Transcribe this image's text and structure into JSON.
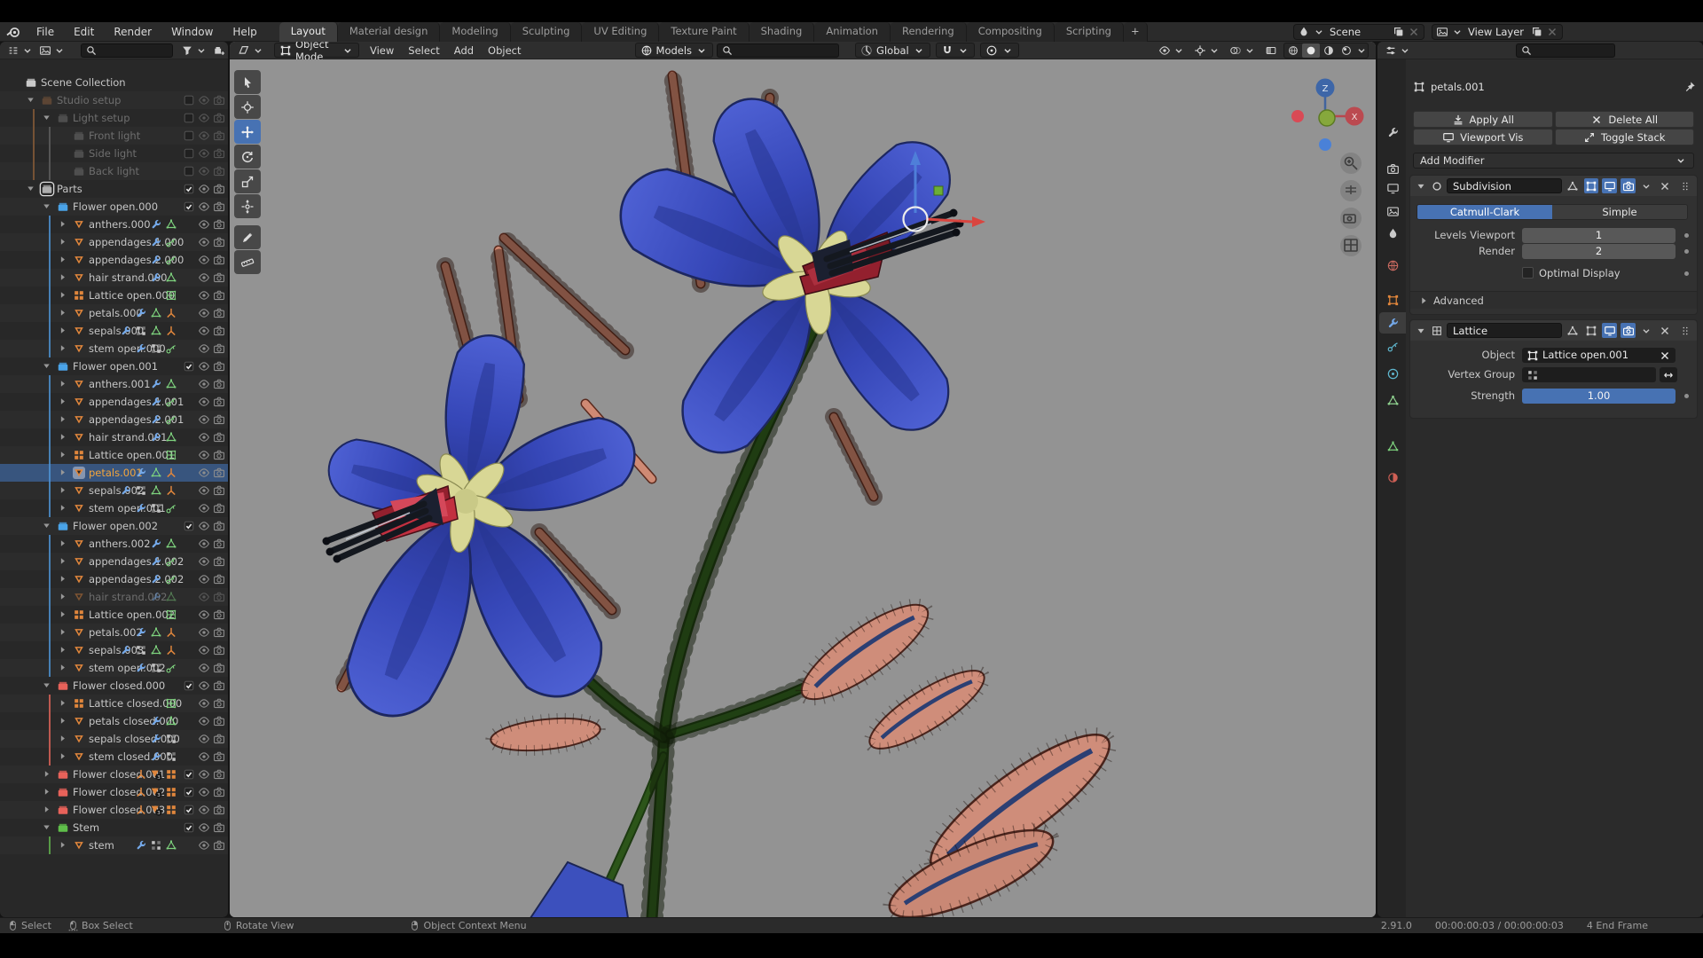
{
  "colors": {
    "accent": "#4772b3",
    "selection": "#38557e",
    "viewport_bg": "#939393",
    "collection_blue": "#4aa3e8",
    "collection_red": "#e8625a",
    "collection_green": "#5fbf4a"
  },
  "topbar": {
    "menus": [
      "File",
      "Edit",
      "Render",
      "Window",
      "Help"
    ],
    "workspaces": [
      "Layout",
      "Material design",
      "Modeling",
      "Sculpting",
      "UV Editing",
      "Texture Paint",
      "Shading",
      "Animation",
      "Rendering",
      "Compositing",
      "Scripting"
    ],
    "active_workspace": "Layout",
    "new_workspace_label": "+",
    "scene_selector": {
      "label": "Scene"
    },
    "view_layer_selector": {
      "label": "View Layer"
    }
  },
  "viewport": {
    "mode": "Object Mode",
    "menus": [
      "View",
      "Select",
      "Add",
      "Object"
    ],
    "asset_dropdown_label": "Models",
    "orientation": "Global",
    "gizmo_z": "Z",
    "gizmo_x": "X"
  },
  "toolbar": {
    "tools": [
      "select-box",
      "cursor",
      "move",
      "rotate",
      "scale",
      "transform",
      "annotate",
      "measure"
    ],
    "active_tool": "move"
  },
  "outliner": {
    "rows": [
      {
        "label": "Scene Collection",
        "depth": 0,
        "icon": "coll",
        "color": "#c9c9c9",
        "expand": "none",
        "toggles": "none",
        "bars": []
      },
      {
        "label": "Studio setup",
        "depth": 1,
        "icon": "coll",
        "color": "#96653f",
        "expand": "open",
        "dim": true,
        "toggles": "col-un",
        "bars": []
      },
      {
        "label": "Light setup",
        "depth": 2,
        "icon": "coll",
        "color": "#7a7a7a",
        "expand": "open",
        "dim": true,
        "toggles": "col-un",
        "bars": [
          [
            1,
            "#8a5c38"
          ]
        ]
      },
      {
        "label": "Front light",
        "depth": 3,
        "icon": "coll",
        "color": "#7a7a7a",
        "expand": "none",
        "dim": true,
        "toggles": "col-un",
        "bars": [
          [
            1,
            "#8a5c38"
          ],
          [
            2,
            "#606060"
          ]
        ]
      },
      {
        "label": "Side light",
        "depth": 3,
        "icon": "coll",
        "color": "#7a7a7a",
        "expand": "none",
        "dim": true,
        "toggles": "col-un",
        "bars": [
          [
            1,
            "#8a5c38"
          ],
          [
            2,
            "#606060"
          ]
        ]
      },
      {
        "label": "Back light",
        "depth": 3,
        "icon": "coll",
        "color": "#7a7a7a",
        "expand": "none",
        "dim": true,
        "toggles": "col-un",
        "bars": [
          [
            1,
            "#8a5c38"
          ],
          [
            2,
            "#606060"
          ]
        ]
      },
      {
        "label": "Parts",
        "depth": 1,
        "icon": "coll",
        "color": "#adadad",
        "expand": "open",
        "active": true,
        "toggles": "col-ck",
        "bars": []
      },
      {
        "label": "Flower open.000",
        "depth": 2,
        "icon": "coll",
        "color": "#4aa3e8",
        "expand": "open",
        "toggles": "col-ck",
        "bars": []
      },
      {
        "label": "anthers.000",
        "depth": 3,
        "icon": "mesh",
        "expand": "leaf",
        "badges": [
          "wrench",
          "data"
        ],
        "toggles": "obj",
        "bars": [
          [
            2,
            "#4f96d8"
          ]
        ]
      },
      {
        "label": "appendages 1.000",
        "depth": 3,
        "icon": "mesh",
        "expand": "leaf",
        "badges": [
          "wrench",
          "part"
        ],
        "toggles": "obj",
        "bars": [
          [
            2,
            "#4f96d8"
          ]
        ]
      },
      {
        "label": "appendages 2.000",
        "depth": 3,
        "icon": "mesh",
        "expand": "leaf",
        "badges": [
          "wrench",
          "part"
        ],
        "toggles": "obj",
        "bars": [
          [
            2,
            "#4f96d8"
          ]
        ]
      },
      {
        "label": "hair strand.000",
        "depth": 3,
        "icon": "mesh",
        "expand": "leaf",
        "badges": [
          "wrench",
          "data"
        ],
        "toggles": "obj",
        "bars": [
          [
            2,
            "#4f96d8"
          ]
        ]
      },
      {
        "label": "Lattice open.000",
        "depth": 3,
        "icon": "latt",
        "expand": "leaf",
        "badges": [
          "latg"
        ],
        "toggles": "obj",
        "bars": [
          [
            2,
            "#4f96d8"
          ]
        ]
      },
      {
        "label": "petals.000",
        "depth": 3,
        "icon": "mesh",
        "expand": "leaf",
        "badges": [
          "wrench",
          "data",
          "empty"
        ],
        "toggles": "obj",
        "bars": [
          [
            2,
            "#4f96d8"
          ]
        ]
      },
      {
        "label": "sepals.000",
        "depth": 3,
        "icon": "mesh",
        "expand": "leaf",
        "badges": [
          "wrench",
          "group",
          "data",
          "empty"
        ],
        "toggles": "obj",
        "bars": [
          [
            2,
            "#4f96d8"
          ]
        ]
      },
      {
        "label": "stem open.000",
        "depth": 3,
        "icon": "mesh",
        "expand": "leaf",
        "badges": [
          "wrench",
          "group",
          "part"
        ],
        "toggles": "obj",
        "bars": [
          [
            2,
            "#4f96d8"
          ]
        ]
      },
      {
        "label": "Flower open.001",
        "depth": 2,
        "icon": "coll",
        "color": "#4aa3e8",
        "expand": "open",
        "toggles": "col-ck",
        "bars": []
      },
      {
        "label": "anthers.001",
        "depth": 3,
        "icon": "mesh",
        "expand": "leaf",
        "badges": [
          "wrench",
          "data"
        ],
        "toggles": "obj",
        "bars": [
          [
            2,
            "#4f96d8"
          ]
        ]
      },
      {
        "label": "appendages 1.001",
        "depth": 3,
        "icon": "mesh",
        "expand": "leaf",
        "badges": [
          "wrench",
          "part"
        ],
        "toggles": "obj",
        "bars": [
          [
            2,
            "#4f96d8"
          ]
        ]
      },
      {
        "label": "appendages 2.001",
        "depth": 3,
        "icon": "mesh",
        "expand": "leaf",
        "badges": [
          "wrench",
          "part"
        ],
        "toggles": "obj",
        "bars": [
          [
            2,
            "#4f96d8"
          ]
        ]
      },
      {
        "label": "hair strand.001",
        "depth": 3,
        "icon": "mesh",
        "expand": "leaf",
        "badges": [
          "wrench",
          "data"
        ],
        "toggles": "obj",
        "bars": [
          [
            2,
            "#4f96d8"
          ]
        ]
      },
      {
        "label": "Lattice open.001",
        "depth": 3,
        "icon": "latt",
        "expand": "leaf",
        "badges": [
          "latg"
        ],
        "toggles": "obj",
        "bars": [
          [
            2,
            "#4f96d8"
          ]
        ]
      },
      {
        "label": "petals.001",
        "depth": 3,
        "icon": "mesh",
        "expand": "leaf",
        "selected": true,
        "badges": [
          "wrench",
          "data",
          "empty"
        ],
        "toggles": "obj",
        "bars": [
          [
            2,
            "#4f96d8"
          ]
        ]
      },
      {
        "label": "sepals.002",
        "depth": 3,
        "icon": "mesh",
        "expand": "leaf",
        "badges": [
          "wrench",
          "group",
          "data",
          "empty"
        ],
        "toggles": "obj",
        "bars": [
          [
            2,
            "#4f96d8"
          ]
        ]
      },
      {
        "label": "stem open.001",
        "depth": 3,
        "icon": "mesh",
        "expand": "leaf",
        "badges": [
          "wrench",
          "group",
          "part"
        ],
        "toggles": "obj",
        "bars": [
          [
            2,
            "#4f96d8"
          ]
        ]
      },
      {
        "label": "Flower open.002",
        "depth": 2,
        "icon": "coll",
        "color": "#4aa3e8",
        "expand": "open",
        "toggles": "col-ck",
        "bars": []
      },
      {
        "label": "anthers.002",
        "depth": 3,
        "icon": "mesh",
        "expand": "leaf",
        "badges": [
          "wrench",
          "data"
        ],
        "toggles": "obj",
        "bars": [
          [
            2,
            "#4f96d8"
          ]
        ]
      },
      {
        "label": "appendages 1.002",
        "depth": 3,
        "icon": "mesh",
        "expand": "leaf",
        "badges": [
          "wrench",
          "part"
        ],
        "toggles": "obj",
        "bars": [
          [
            2,
            "#4f96d8"
          ]
        ]
      },
      {
        "label": "appendages 2.002",
        "depth": 3,
        "icon": "mesh",
        "expand": "leaf",
        "badges": [
          "wrench",
          "part"
        ],
        "toggles": "obj",
        "bars": [
          [
            2,
            "#4f96d8"
          ]
        ]
      },
      {
        "label": "hair strand.002",
        "depth": 3,
        "icon": "mesh",
        "expand": "leaf",
        "dim": true,
        "badges": [
          "wrench",
          "data"
        ],
        "toggles": "obj",
        "bars": [
          [
            2,
            "#4f96d8"
          ]
        ]
      },
      {
        "label": "Lattice open.002",
        "depth": 3,
        "icon": "latt",
        "expand": "leaf",
        "badges": [
          "latg"
        ],
        "toggles": "obj",
        "bars": [
          [
            2,
            "#4f96d8"
          ]
        ]
      },
      {
        "label": "petals.002",
        "depth": 3,
        "icon": "mesh",
        "expand": "leaf",
        "badges": [
          "wrench",
          "data",
          "empty"
        ],
        "toggles": "obj",
        "bars": [
          [
            2,
            "#4f96d8"
          ]
        ]
      },
      {
        "label": "sepals.003",
        "depth": 3,
        "icon": "mesh",
        "expand": "leaf",
        "badges": [
          "wrench",
          "group",
          "data",
          "empty"
        ],
        "toggles": "obj",
        "bars": [
          [
            2,
            "#4f96d8"
          ]
        ]
      },
      {
        "label": "stem open.002",
        "depth": 3,
        "icon": "mesh",
        "expand": "leaf",
        "badges": [
          "wrench",
          "group",
          "part"
        ],
        "toggles": "obj",
        "bars": [
          [
            2,
            "#4f96d8"
          ]
        ]
      },
      {
        "label": "Flower closed.000",
        "depth": 2,
        "icon": "coll",
        "color": "#e8625a",
        "expand": "open",
        "toggles": "col-ck",
        "bars": []
      },
      {
        "label": "Lattice closed.000",
        "depth": 3,
        "icon": "latt",
        "expand": "leaf",
        "badges": [
          "latg"
        ],
        "toggles": "obj",
        "bars": [
          [
            2,
            "#e3655a"
          ]
        ]
      },
      {
        "label": "petals closed.000",
        "depth": 3,
        "icon": "mesh",
        "expand": "leaf",
        "badges": [
          "wrench",
          "data"
        ],
        "toggles": "obj",
        "bars": [
          [
            2,
            "#e3655a"
          ]
        ]
      },
      {
        "label": "sepals closed.000",
        "depth": 3,
        "icon": "mesh",
        "expand": "leaf",
        "badges": [
          "wrench",
          "group"
        ],
        "toggles": "obj",
        "bars": [
          [
            2,
            "#e3655a"
          ]
        ]
      },
      {
        "label": "stem closed.000",
        "depth": 3,
        "icon": "mesh",
        "expand": "leaf",
        "badges": [
          "wrench",
          "group"
        ],
        "toggles": "obj",
        "bars": [
          [
            2,
            "#e3655a"
          ]
        ]
      },
      {
        "label": "Flower closed.001",
        "depth": 2,
        "icon": "coll",
        "color": "#e8625a",
        "expand": "closed",
        "badges": [
          "emptyO",
          "mesh3",
          "lattO"
        ],
        "toggles": "col-ck",
        "bars": []
      },
      {
        "label": "Flower closed.002",
        "depth": 2,
        "icon": "coll",
        "color": "#e8625a",
        "expand": "closed",
        "badges": [
          "emptyO",
          "mesh3",
          "lattO"
        ],
        "toggles": "col-ck",
        "bars": []
      },
      {
        "label": "Flower closed.003",
        "depth": 2,
        "icon": "coll",
        "color": "#e8625a",
        "expand": "closed",
        "badges": [
          "emptyO",
          "mesh3",
          "lattO"
        ],
        "toggles": "col-ck",
        "bars": []
      },
      {
        "label": "Stem",
        "depth": 2,
        "icon": "coll",
        "color": "#5fbf4a",
        "expand": "open",
        "toggles": "col-ck",
        "bars": []
      },
      {
        "label": "stem",
        "depth": 3,
        "icon": "mesh",
        "expand": "leaf",
        "badges": [
          "wrench",
          "group",
          "data"
        ],
        "toggles": "obj",
        "bars": [
          [
            2,
            "#63b74e"
          ]
        ]
      }
    ]
  },
  "properties": {
    "breadcrumb": "petals.001",
    "actions": {
      "apply_all": "Apply All",
      "delete_all": "Delete All",
      "viewport_vis": "Viewport Vis",
      "toggle_stack": "Toggle Stack"
    },
    "add_modifier": "Add Modifier",
    "subdivision": {
      "name": "Subdivision",
      "type_catmull": "Catmull-Clark",
      "type_simple": "Simple",
      "active_type": "Catmull-Clark",
      "levels_viewport_label": "Levels Viewport",
      "levels_viewport": "1",
      "render_label": "Render",
      "render": "2",
      "optimal_display_label": "Optimal Display",
      "optimal_display_checked": false,
      "advanced_label": "Advanced"
    },
    "lattice": {
      "name": "Lattice",
      "object_label": "Object",
      "object": "Lattice open.001",
      "vertex_group_label": "Vertex Group",
      "strength_label": "Strength",
      "strength": "1.00"
    }
  },
  "statusbar": {
    "hints": [
      {
        "icon": "mouse-left",
        "label": "Select"
      },
      {
        "icon": "mouse-drag",
        "label": "Box Select"
      },
      {
        "icon": "mouse-middle",
        "label": "Rotate View"
      },
      {
        "icon": "mouse-right",
        "label": "Object Context Menu"
      }
    ],
    "version": "2.91.0",
    "playback": "00:00:00:03 / 00:00:00:03",
    "frame": "4 End Frame"
  }
}
